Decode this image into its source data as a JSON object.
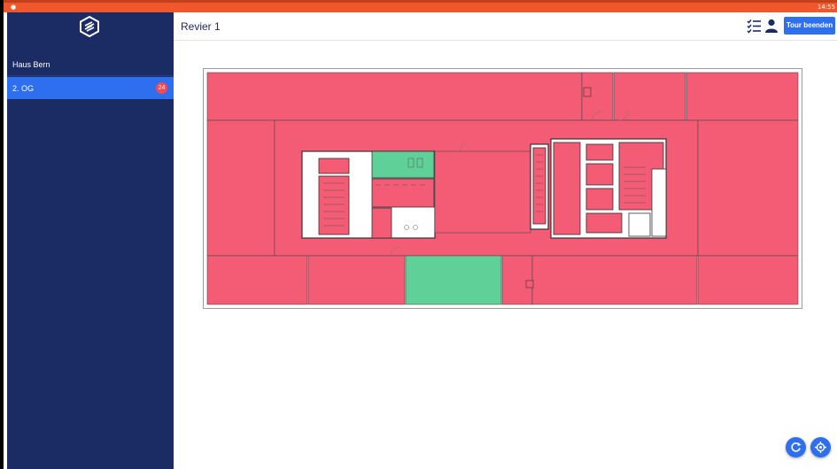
{
  "statusbar": {
    "left": "●",
    "time": "14:55"
  },
  "sidebar": {
    "building": "Haus Bern",
    "floors": [
      {
        "label": "2. OG",
        "badge": "24"
      }
    ]
  },
  "header": {
    "title": "Revier 1",
    "end_tour_label": "Tour beenden"
  },
  "colors": {
    "sidebar": "#1b2b63",
    "accent": "#2e6ff0",
    "room_open": "#f45b74",
    "room_done": "#5fd198",
    "badge": "#f04a55",
    "statusbar": "#f0572a"
  },
  "icons": {
    "logo": "app-logo-icon",
    "checklist": "checklist-icon",
    "user": "user-icon",
    "refresh": "refresh-icon",
    "locate": "crosshair-icon"
  },
  "floorplan": {
    "rooms_open_status": "unchecked",
    "rooms_done_status": "checked"
  }
}
